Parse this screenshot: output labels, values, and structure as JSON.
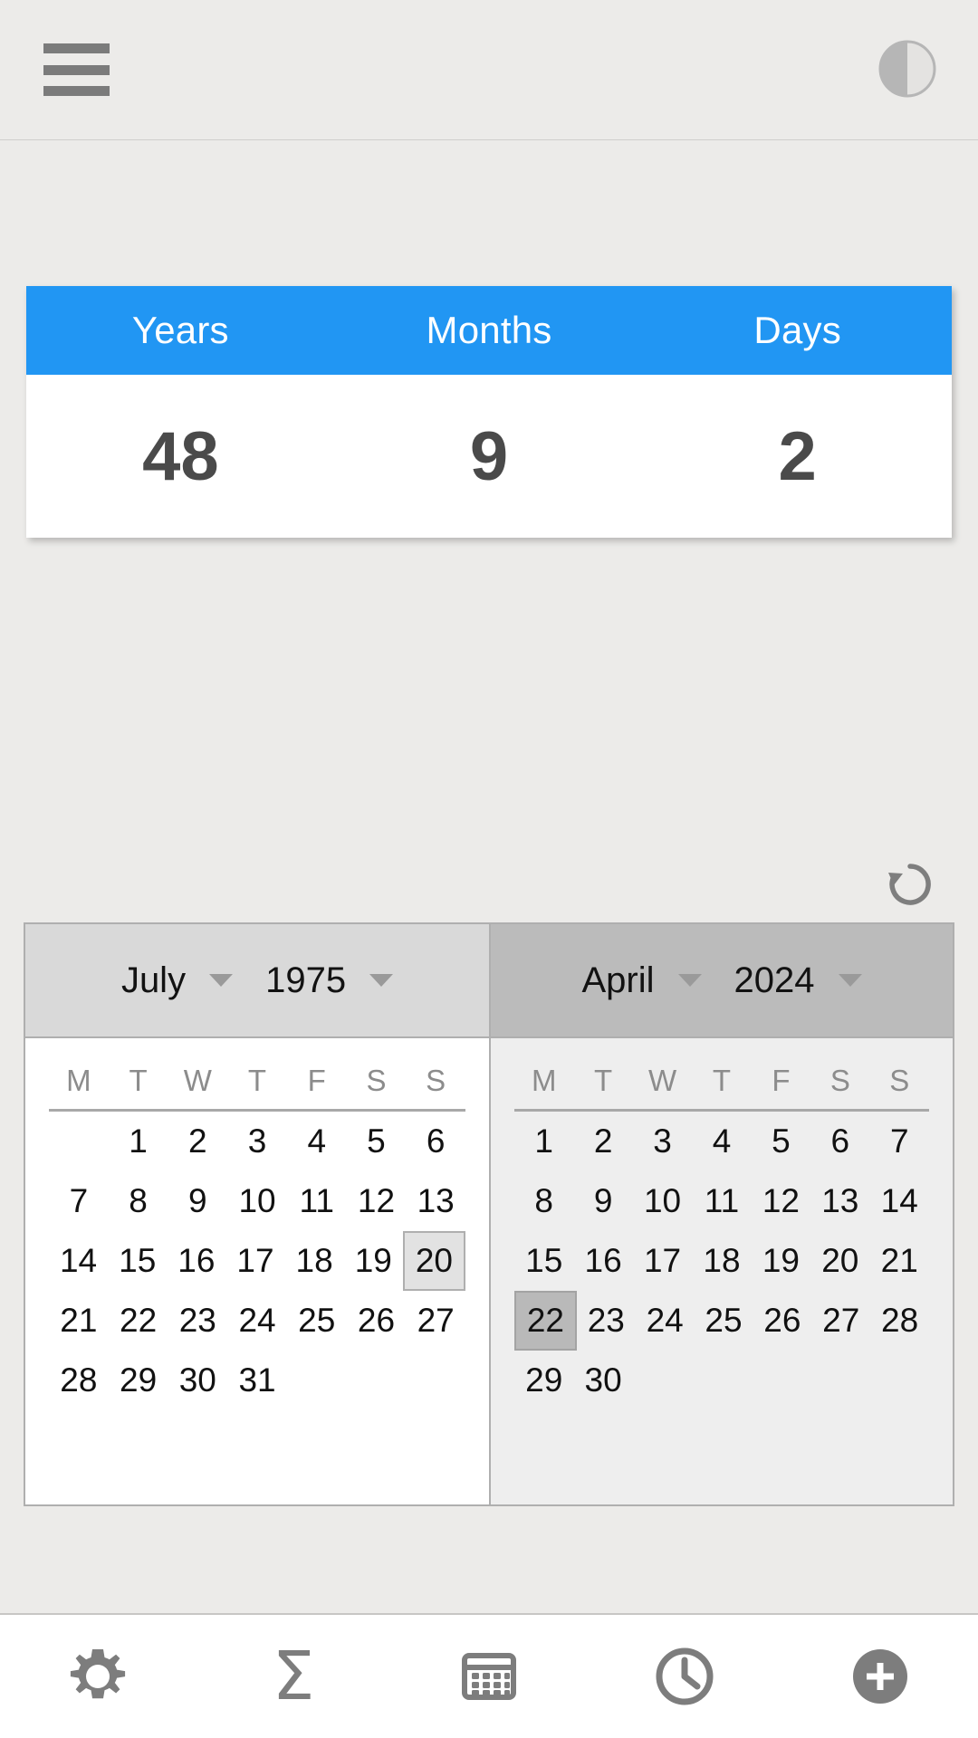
{
  "appbar": {
    "menu_icon": "hamburger-menu-icon",
    "theme_icon": "half-circle-contrast-icon"
  },
  "result": {
    "columns": [
      "Years",
      "Months",
      "Days"
    ],
    "values": [
      "48",
      "9",
      "2"
    ],
    "header_color": "#2196F3",
    "value_color": "#4A4A4A"
  },
  "refresh": {
    "icon": "refresh-reset-icon"
  },
  "calendars": {
    "weekdays": [
      "M",
      "T",
      "W",
      "T",
      "F",
      "S",
      "S"
    ],
    "left": {
      "month": "July",
      "year": "1975",
      "selected_day": "20",
      "lead_blanks": 1,
      "days_in_month": 31,
      "weeks": [
        [
          "",
          "1",
          "2",
          "3",
          "4",
          "5",
          "6"
        ],
        [
          "7",
          "8",
          "9",
          "10",
          "11",
          "12",
          "13"
        ],
        [
          "14",
          "15",
          "16",
          "17",
          "18",
          "19",
          "20"
        ],
        [
          "21",
          "22",
          "23",
          "24",
          "25",
          "26",
          "27"
        ],
        [
          "28",
          "29",
          "30",
          "31",
          "",
          "",
          ""
        ]
      ]
    },
    "right": {
      "month": "April",
      "year": "2024",
      "selected_day": "22",
      "lead_blanks": 0,
      "days_in_month": 30,
      "weeks": [
        [
          "1",
          "2",
          "3",
          "4",
          "5",
          "6",
          "7"
        ],
        [
          "8",
          "9",
          "10",
          "11",
          "12",
          "13",
          "14"
        ],
        [
          "15",
          "16",
          "17",
          "18",
          "19",
          "20",
          "21"
        ],
        [
          "22",
          "23",
          "24",
          "25",
          "26",
          "27",
          "28"
        ],
        [
          "29",
          "30",
          "",
          "",
          "",
          "",
          ""
        ]
      ]
    }
  },
  "bottombar": {
    "items": [
      {
        "icon": "gear-settings-icon",
        "glyph": ""
      },
      {
        "icon": "sigma-sum-icon",
        "glyph": "Σ"
      },
      {
        "icon": "calendar-icon",
        "glyph": ""
      },
      {
        "icon": "clock-icon",
        "glyph": ""
      },
      {
        "icon": "add-plus-button",
        "glyph": ""
      }
    ]
  }
}
